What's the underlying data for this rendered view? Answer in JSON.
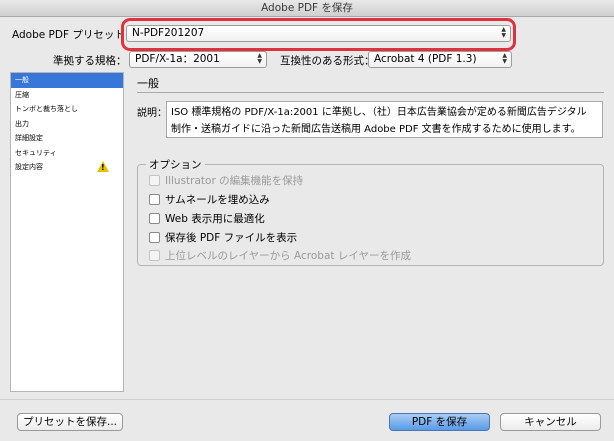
{
  "window": {
    "title": "Adobe PDF を保存"
  },
  "preset": {
    "label": "Adobe PDF プリセット：",
    "value": "N-PDF201207"
  },
  "standard": {
    "label": "準拠する規格：",
    "value": "PDF/X-1a：2001"
  },
  "compat": {
    "label": "互換性のある形式：",
    "value": "Acrobat 4 (PDF 1.3)"
  },
  "sidebar": {
    "items": [
      {
        "label": "一般",
        "selected": true,
        "warning": false
      },
      {
        "label": "圧縮",
        "selected": false,
        "warning": false
      },
      {
        "label": "トンボと裁ち落とし",
        "selected": false,
        "warning": false
      },
      {
        "label": "出力",
        "selected": false,
        "warning": false
      },
      {
        "label": "詳細設定",
        "selected": false,
        "warning": false
      },
      {
        "label": "セキュリティ",
        "selected": false,
        "warning": false
      },
      {
        "label": "設定内容",
        "selected": false,
        "warning": true,
        "icon": "warning-icon"
      }
    ]
  },
  "general": {
    "title": "一般",
    "description_label": "説明：",
    "description_line1": "ISO 標準規格の PDF/X-1a:2001 に準拠し、（社）日本広告業協会が定める新聞広告デジタル",
    "description_line2": "制作・送稿ガイドに沿った新聞広告送稿用 Adobe PDF 文書を作成するために使用します。"
  },
  "options": {
    "title": "オプション",
    "items": [
      {
        "label": "Illustrator の編集機能を保持",
        "checked": false,
        "disabled": true
      },
      {
        "label": "サムネールを埋め込み",
        "checked": false,
        "disabled": false
      },
      {
        "label": "Web 表示用に最適化",
        "checked": false,
        "disabled": false
      },
      {
        "label": "保存後 PDF ファイルを表示",
        "checked": false,
        "disabled": false
      },
      {
        "label": "上位レベルのレイヤーから Acrobat レイヤーを作成",
        "checked": false,
        "disabled": true
      }
    ]
  },
  "buttons": {
    "save_preset": "プリセットを保存...",
    "save_pdf": "PDF を保存",
    "cancel": "キャンセル"
  },
  "colors": {
    "highlight": "#e0323d",
    "selection": "#3876d8",
    "default_button": "#5a9ae6"
  }
}
